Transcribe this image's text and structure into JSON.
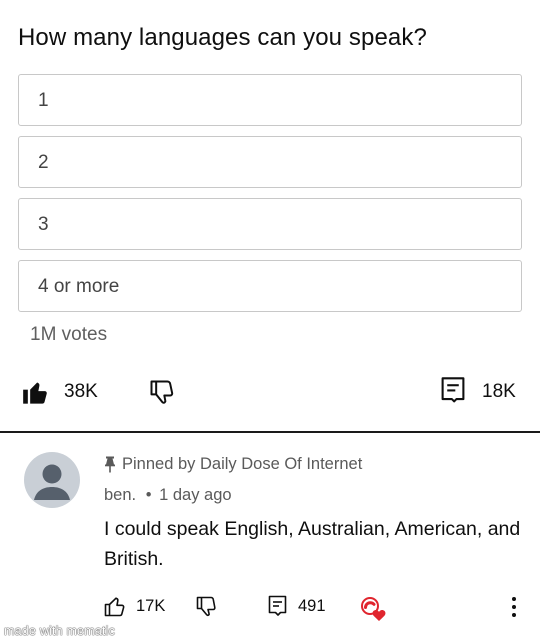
{
  "poll": {
    "question": "How many languages can you speak?",
    "options": [
      "1",
      "2",
      "3",
      "4 or more"
    ],
    "votes": "1M votes"
  },
  "actions": {
    "likes": "38K",
    "comments": "18K",
    "like_icon": "thumbs-up-filled-icon",
    "dislike_icon": "thumbs-down-icon",
    "comment_icon": "comment-icon"
  },
  "comment": {
    "pinned_label": "Pinned by Daily Dose Of Internet",
    "author": "ben.",
    "separator": "•",
    "time": "1 day ago",
    "text": "I could speak English, Australian, American, and British.",
    "likes": "17K",
    "replies": "491",
    "heart_color": "#e0252e"
  },
  "watermark": "made with mematic"
}
